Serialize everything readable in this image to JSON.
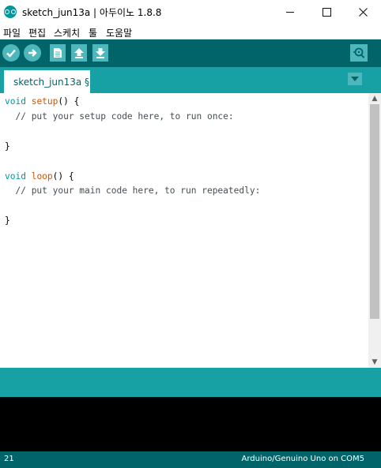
{
  "window": {
    "title": "sketch_jun13a | 아두이노 1.8.8",
    "controls": [
      "minimize",
      "maximize",
      "close"
    ]
  },
  "menu": {
    "items": [
      "파일",
      "편집",
      "스케치",
      "툴",
      "도움말"
    ]
  },
  "toolbar": {
    "buttons": [
      {
        "name": "verify",
        "icon": "check-icon"
      },
      {
        "name": "upload",
        "icon": "arrow-right-icon"
      },
      {
        "name": "new",
        "icon": "document-icon"
      },
      {
        "name": "open",
        "icon": "arrow-up-icon"
      },
      {
        "name": "save",
        "icon": "arrow-down-icon"
      }
    ],
    "serial_monitor_icon": "magnifier-icon"
  },
  "tabs": [
    {
      "label": "sketch_jun13a §",
      "active": true
    }
  ],
  "editor": {
    "lines": [
      "void setup() {",
      "  // put your setup code here, to run once:",
      "",
      "}",
      "",
      "void loop() {",
      "  // put your main code here, to run repeatedly:",
      "",
      "}"
    ]
  },
  "status": {
    "line_number": "21",
    "board": "Arduino/Genuino Uno on COM5"
  },
  "colors": {
    "toolbar": "#006468",
    "tabbar": "#17a1a5",
    "button": "#4db7bb",
    "keyword": "#00979c",
    "function": "#d35400",
    "console": "#000000"
  }
}
